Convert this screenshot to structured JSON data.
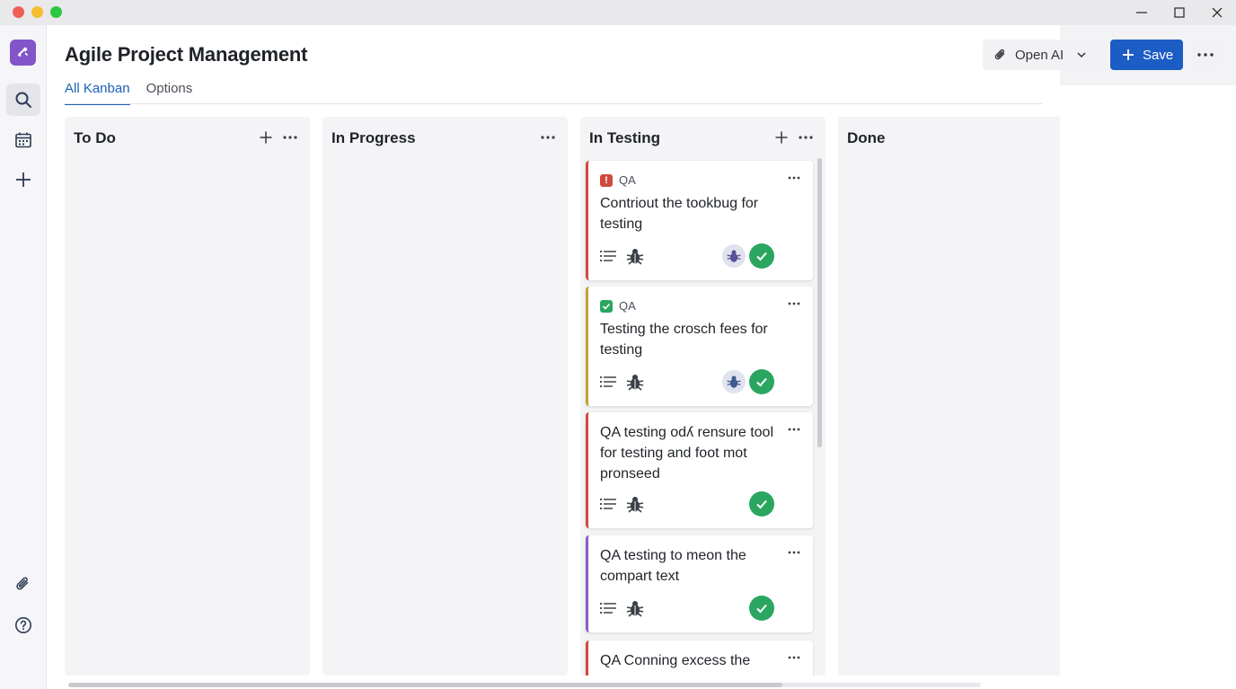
{
  "window": {
    "controls": [
      "minimize-icon",
      "maximize-icon",
      "close-icon"
    ]
  },
  "rail": {
    "items": [
      "app-logo",
      "search-icon",
      "calendar-icon",
      "plus-icon",
      "paperclip-icon",
      "help-icon"
    ]
  },
  "header": {
    "title": "Agile Project Management",
    "tabs": [
      {
        "label": "All Kanban",
        "active": true
      },
      {
        "label": "Options",
        "active": false
      }
    ],
    "open_ai_label": "Open AI",
    "save_label": "Save"
  },
  "columns": [
    {
      "title": "To Do",
      "cards": []
    },
    {
      "title": "In Progress",
      "cards": []
    },
    {
      "title": "In Testing",
      "cards": [
        {
          "tag": "QA",
          "tag_type": "alert",
          "title": "Contriout the tookbug for testing",
          "accent": "#d04a3f",
          "avatar": true,
          "done": true
        },
        {
          "tag": "QA",
          "tag_type": "check",
          "title": "Testing the crosch fees for testing",
          "accent": "#c2a233",
          "avatar": true,
          "done": true
        },
        {
          "tag": "",
          "tag_type": "",
          "title": "QA testing odʎ rensure tool for testing and foot mot pronseed",
          "accent": "#d04a3f",
          "avatar": false,
          "done": true
        },
        {
          "tag": "",
          "tag_type": "",
          "title": "QA testing to meon the compart text",
          "accent": "#8a5cc6",
          "avatar": false,
          "done": true
        },
        {
          "tag": "",
          "tag_type": "",
          "title": "QA Conning excess the",
          "accent": "#d04a3f",
          "avatar": false,
          "done": false
        }
      ]
    },
    {
      "title": "Done",
      "cards": []
    }
  ],
  "colors": {
    "accent_blue": "#1c5cc5",
    "tab_blue": "#1b5fb8",
    "success_green": "#2aa660",
    "alert_red": "#d04a3f",
    "logo_purple": "#8256c9"
  }
}
